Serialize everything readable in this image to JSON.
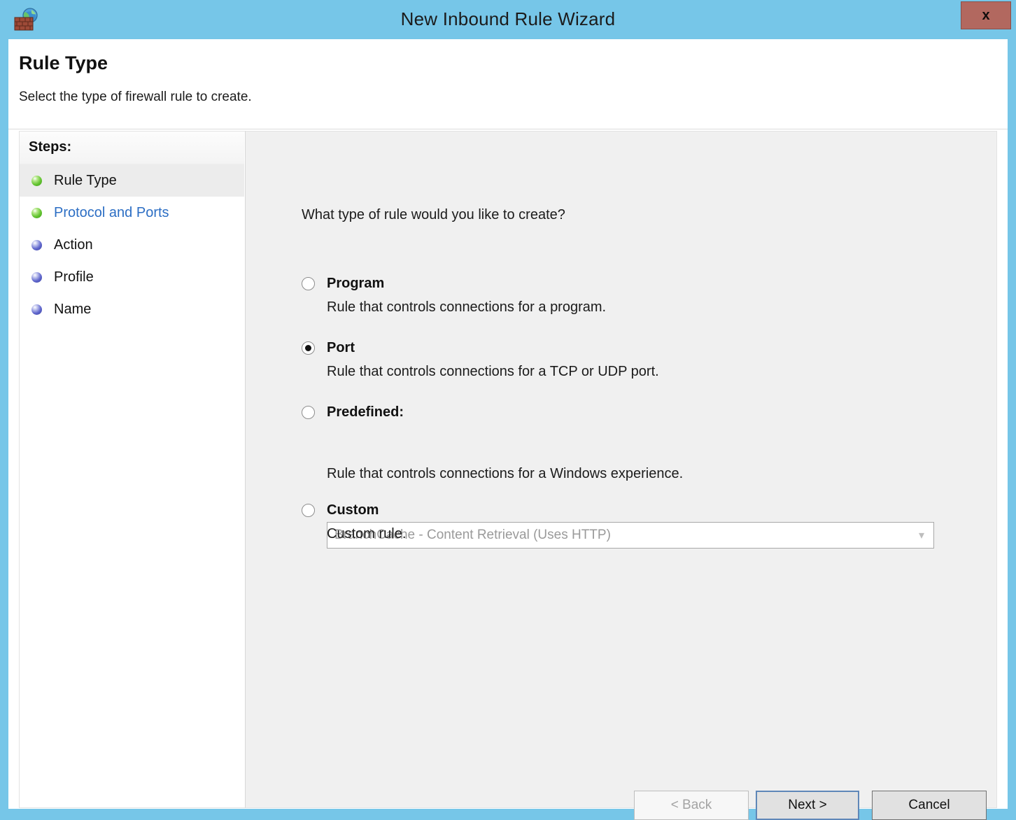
{
  "window": {
    "title": "New Inbound Rule Wizard",
    "icon": "firewall-brickwall-globe-icon",
    "close_label": "x",
    "titlebar_color": "#76c6e8",
    "close_button_color": "#b2685f"
  },
  "header": {
    "title": "Rule Type",
    "subtitle": "Select the type of firewall rule to create."
  },
  "sidebar": {
    "heading": "Steps:",
    "items": [
      {
        "label": "Rule Type",
        "bullet": "green",
        "state": "active"
      },
      {
        "label": "Protocol and Ports",
        "bullet": "green",
        "state": "link"
      },
      {
        "label": "Action",
        "bullet": "blue",
        "state": "pending"
      },
      {
        "label": "Profile",
        "bullet": "blue",
        "state": "pending"
      },
      {
        "label": "Name",
        "bullet": "blue",
        "state": "pending"
      }
    ]
  },
  "main": {
    "question": "What type of rule would you like to create?",
    "options": [
      {
        "title": "Program",
        "description": "Rule that controls connections for a program.",
        "selected": false
      },
      {
        "title": "Port",
        "description": "Rule that controls connections for a TCP or UDP port.",
        "selected": true
      },
      {
        "title": "Predefined:",
        "description": "Rule that controls connections for a Windows experience.",
        "selected": false
      },
      {
        "title": "Custom",
        "description": "Custom rule.",
        "selected": false
      }
    ],
    "predefined_combo": {
      "value": "BranchCache - Content Retrieval (Uses HTTP)",
      "arrow": "chevron-down-icon",
      "disabled": true
    }
  },
  "footer": {
    "back_label": "< Back",
    "next_label": "Next >",
    "cancel_label": "Cancel",
    "back_disabled": true,
    "next_focus_color": "#5f87b8"
  }
}
